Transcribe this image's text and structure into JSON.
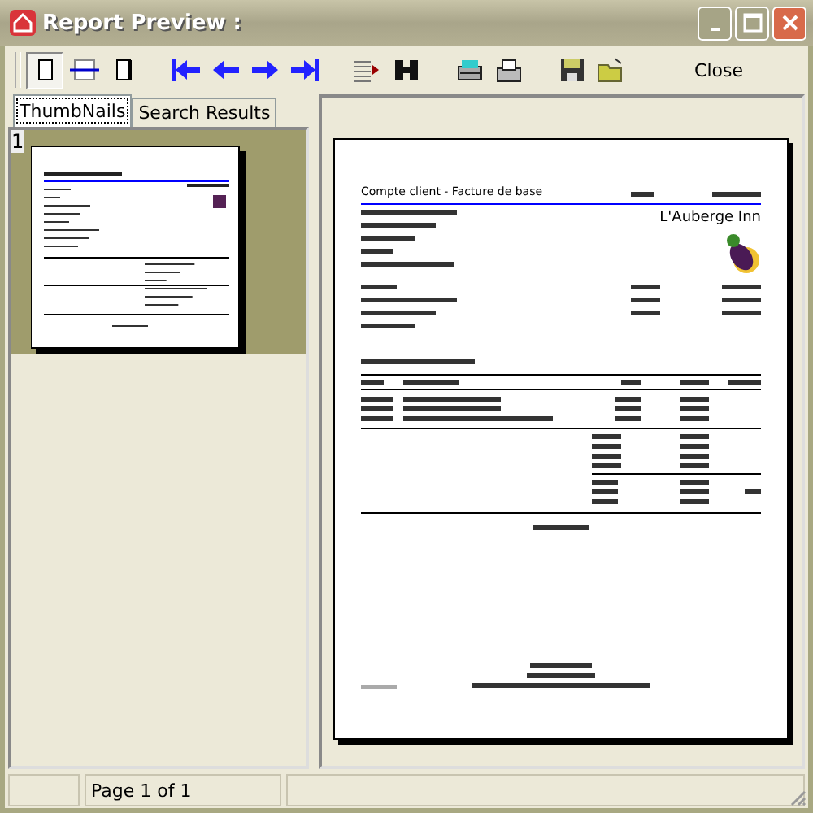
{
  "window": {
    "title": "Report Preview :"
  },
  "view_modes": [
    {
      "kind": "whole-page",
      "selected": true
    },
    {
      "kind": "page-width",
      "selected": false
    },
    {
      "kind": "narrow-page",
      "selected": false
    }
  ],
  "tools": [
    {
      "kind": "first"
    },
    {
      "kind": "prev"
    },
    {
      "kind": "next"
    },
    {
      "kind": "last"
    },
    {
      "kind": "goto"
    },
    {
      "kind": "find"
    },
    {
      "kind": "print-setup"
    },
    {
      "kind": "print"
    },
    {
      "kind": "save"
    },
    {
      "kind": "open"
    }
  ],
  "close_button": {
    "label": "Close"
  },
  "tabs": [
    {
      "label": "ThumbNails",
      "selected": true
    },
    {
      "label": "Search Results",
      "selected": false
    }
  ],
  "thumbnails": [
    {
      "page": "1",
      "selected": true
    }
  ],
  "document": {
    "title": "Compte client - Facture de base",
    "company": "L'Auberge Inn"
  },
  "status_bar": {
    "page": "Page 1 of 1"
  }
}
